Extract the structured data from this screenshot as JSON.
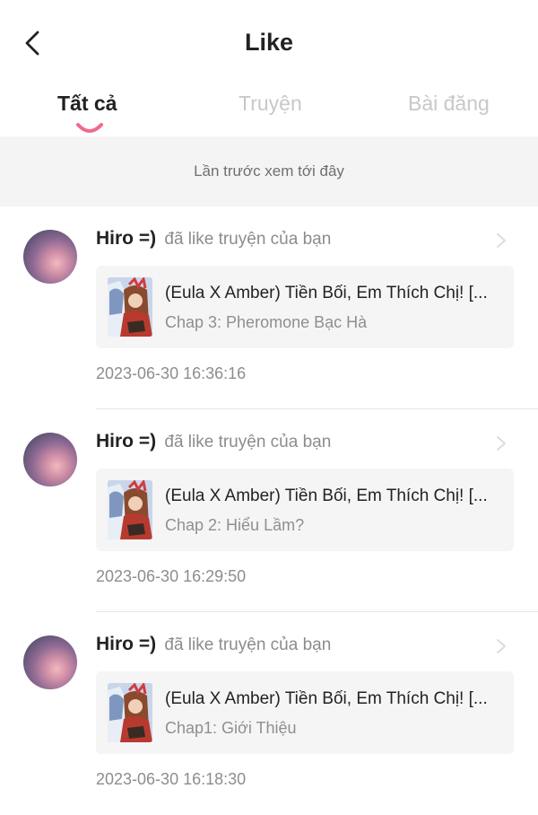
{
  "header": {
    "title": "Like",
    "back_icon": "chevron-left-icon"
  },
  "tabs": [
    {
      "label": "Tất cả",
      "active": true
    },
    {
      "label": "Truyện",
      "active": false
    },
    {
      "label": "Bài đăng",
      "active": false
    }
  ],
  "notice": "Lần trước xem tới đây",
  "colors": {
    "accent": "#f06a8a",
    "background": "#ffffff",
    "panel": "#f4f4f4",
    "card": "#f5f5f5"
  },
  "items": [
    {
      "actor": "Hiro =)",
      "action": "đã like truyện của bạn",
      "story_title": "(Eula X Amber) Tiền Bối, Em Thích Chị! [...",
      "chapter": "Chap 3: Pheromone Bạc Hà",
      "time": "2023-06-30 16:36:16"
    },
    {
      "actor": "Hiro =)",
      "action": "đã like truyện của bạn",
      "story_title": "(Eula X Amber) Tiền Bối, Em Thích Chị! [...",
      "chapter": "Chap 2: Hiểu Lầm?",
      "time": "2023-06-30 16:29:50"
    },
    {
      "actor": "Hiro =)",
      "action": "đã like truyện của bạn",
      "story_title": "(Eula X Amber) Tiền Bối, Em Thích Chị! [...",
      "chapter": "Chap1: Giới Thiệu",
      "time": "2023-06-30 16:18:30"
    }
  ]
}
